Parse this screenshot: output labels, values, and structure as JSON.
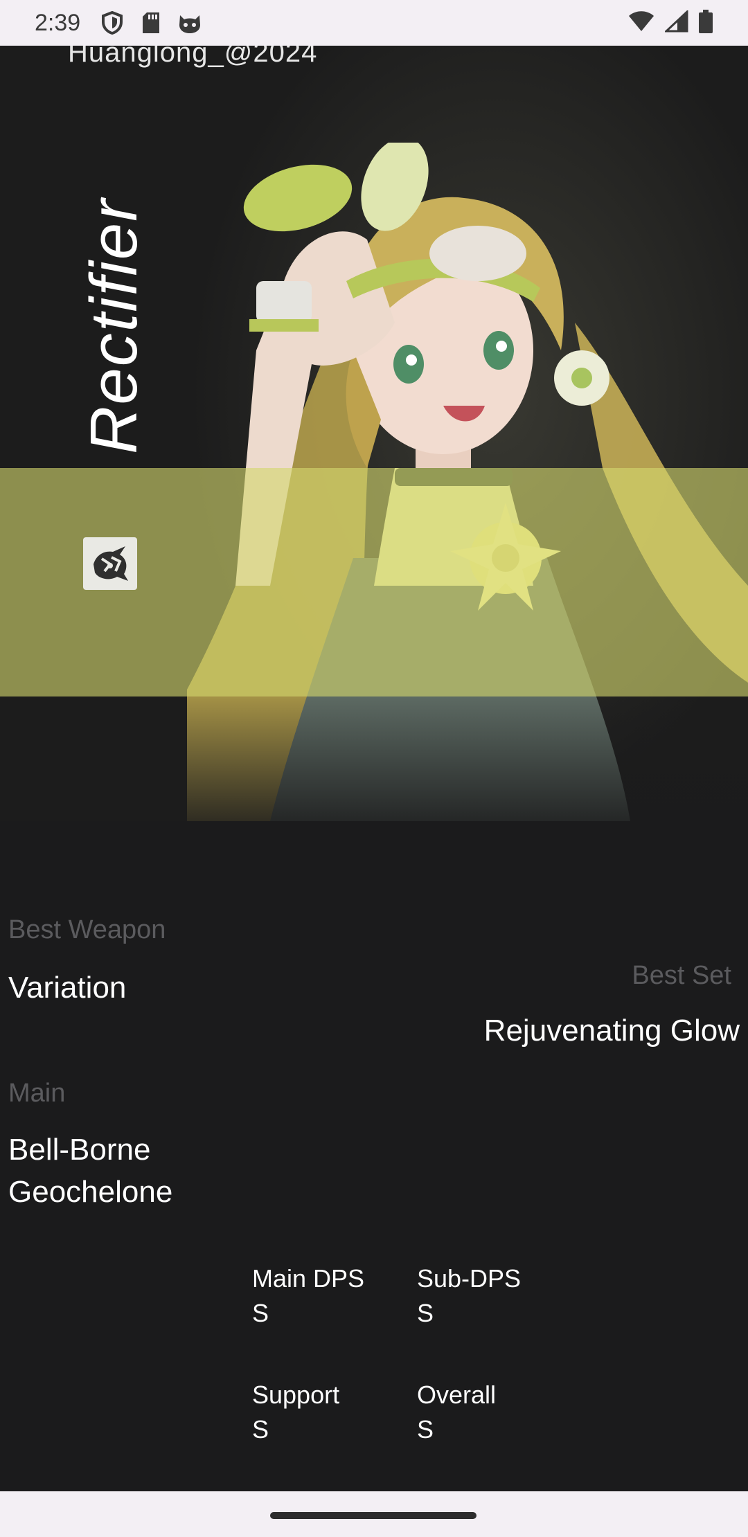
{
  "status_bar": {
    "time": "2:39",
    "icons": [
      "shield-icon",
      "sd-card-icon",
      "cat-face-icon",
      "wifi-icon",
      "signal-icon",
      "battery-icon"
    ]
  },
  "hero": {
    "copyright": "Huanglong_@2024",
    "class_label": "Rectifier",
    "element_band_color": "#d4d66e",
    "element_icon": "aero-element-icon"
  },
  "details": {
    "best_weapon_label": "Best Weapon",
    "best_weapon_value": "Variation",
    "best_set_label": "Best Set",
    "best_set_value": "Rejuvenating Glow",
    "main_label": "Main",
    "main_value_line1": "Bell-Borne",
    "main_value_line2": "Geochelone"
  },
  "ratings": [
    {
      "label": "Main DPS",
      "value": "S"
    },
    {
      "label": "Sub-DPS",
      "value": "S"
    },
    {
      "label": "Support",
      "value": "S"
    },
    {
      "label": "Overall",
      "value": "S"
    }
  ],
  "colors": {
    "background": "#1b1b1c",
    "muted_label": "#5b5b5e",
    "system_bar": "#f3eff4"
  }
}
